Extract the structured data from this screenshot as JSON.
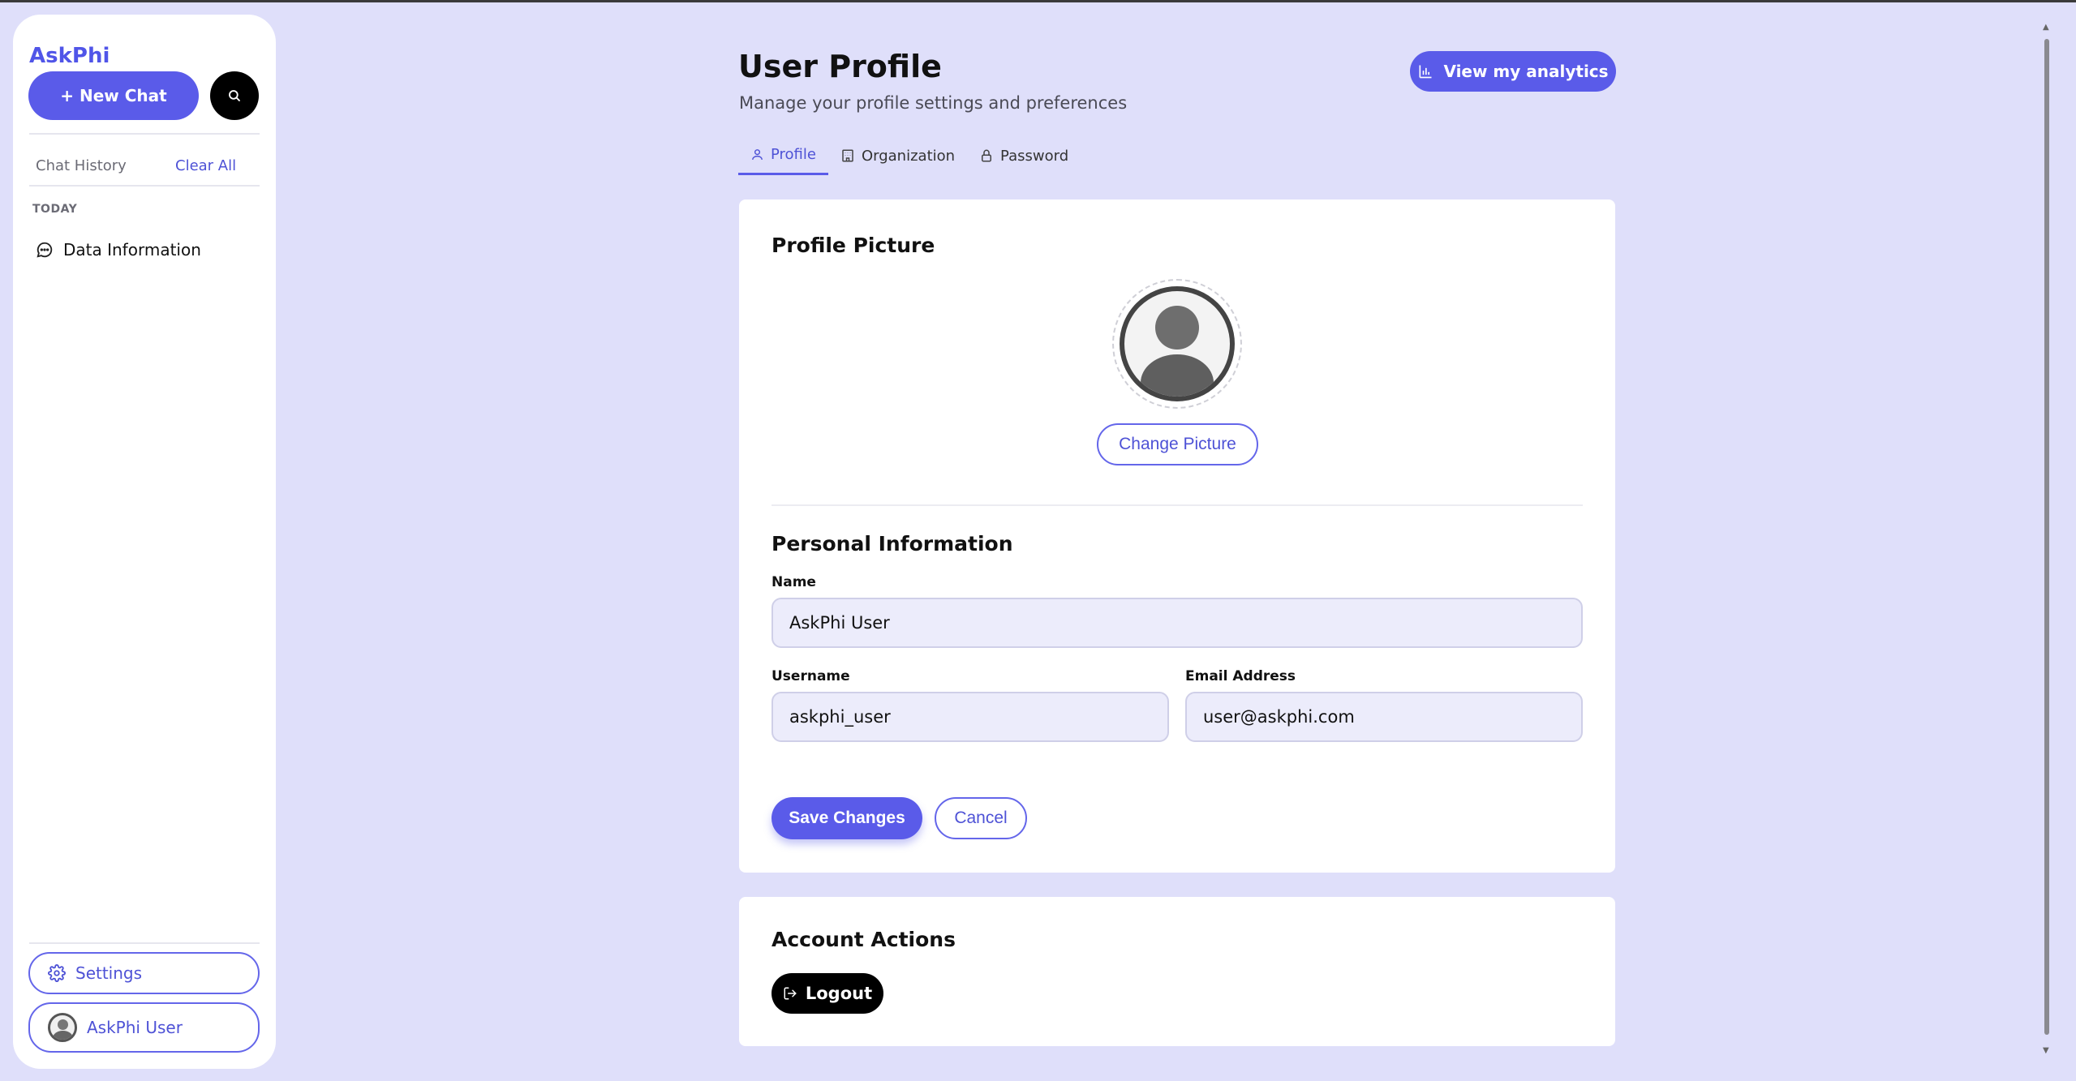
{
  "sidebar": {
    "brand": "AskPhi",
    "new_chat_label": "+ New Chat",
    "history_label": "Chat History",
    "clear_all_label": "Clear All",
    "group_today": "TODAY",
    "history_items": [
      {
        "label": "Data Information"
      }
    ],
    "settings_label": "Settings",
    "user_label": "AskPhi User"
  },
  "header": {
    "title": "User Profile",
    "subtitle": "Manage your profile settings and preferences",
    "analytics_label": "View my analytics"
  },
  "tabs": [
    {
      "label": "Profile",
      "active": true
    },
    {
      "label": "Organization",
      "active": false
    },
    {
      "label": "Password",
      "active": false
    }
  ],
  "profile_picture": {
    "title": "Profile Picture",
    "change_label": "Change Picture"
  },
  "personal_info": {
    "title": "Personal Information",
    "name_label": "Name",
    "name_value": "AskPhi User",
    "username_label": "Username",
    "username_value": "askphi_user",
    "email_label": "Email Address",
    "email_value": "user@askphi.com",
    "save_label": "Save Changes",
    "cancel_label": "Cancel"
  },
  "account_actions": {
    "title": "Account Actions",
    "logout_label": "Logout"
  },
  "colors": {
    "accent": "#5a5be9",
    "background": "#dfdffa",
    "input_bg": "#ececfb"
  }
}
